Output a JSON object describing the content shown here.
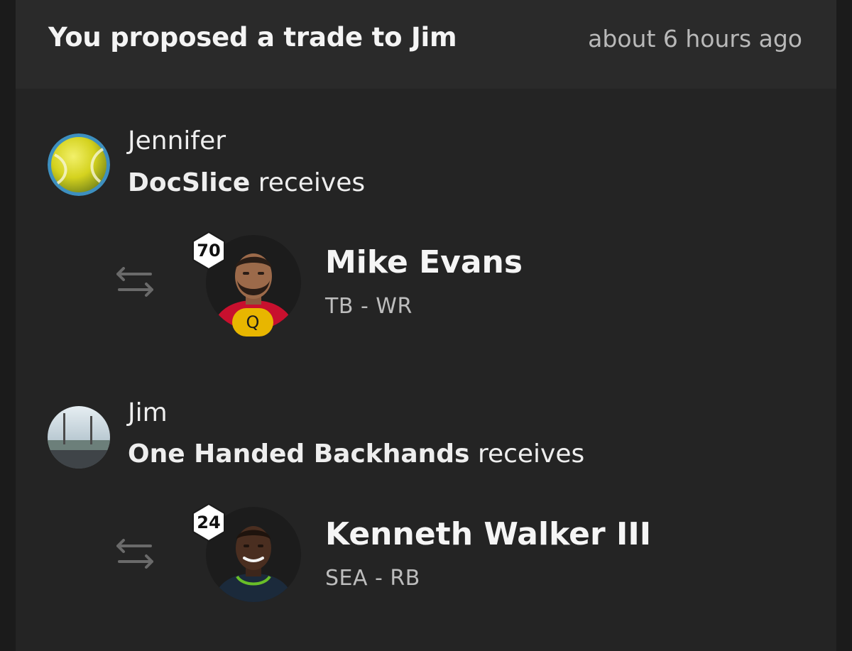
{
  "header": {
    "title": "You proposed a trade to Jim",
    "timestamp": "about 6 hours ago"
  },
  "trades": [
    {
      "owner": "Jennifer",
      "team": "DocSlice",
      "receives_word": "receives",
      "avatar": "tennis-ball-avatar",
      "player": {
        "name": "Mike Evans",
        "meta": "TB - WR",
        "rank": "70",
        "status": "Q",
        "status_color": "#e8b600",
        "jersey_color": "#c8102e"
      }
    },
    {
      "owner": "Jim",
      "team": "One Handed Backhands",
      "receives_word": "receives",
      "avatar": "landscape-photo-avatar",
      "player": {
        "name": "Kenneth Walker III",
        "meta": "SEA - RB",
        "rank": "24",
        "jersey_color": "#1b2a3b"
      }
    }
  ],
  "colors": {
    "background": "#242424",
    "header": "#2a2a2a",
    "accent_status": "#e8b600"
  }
}
